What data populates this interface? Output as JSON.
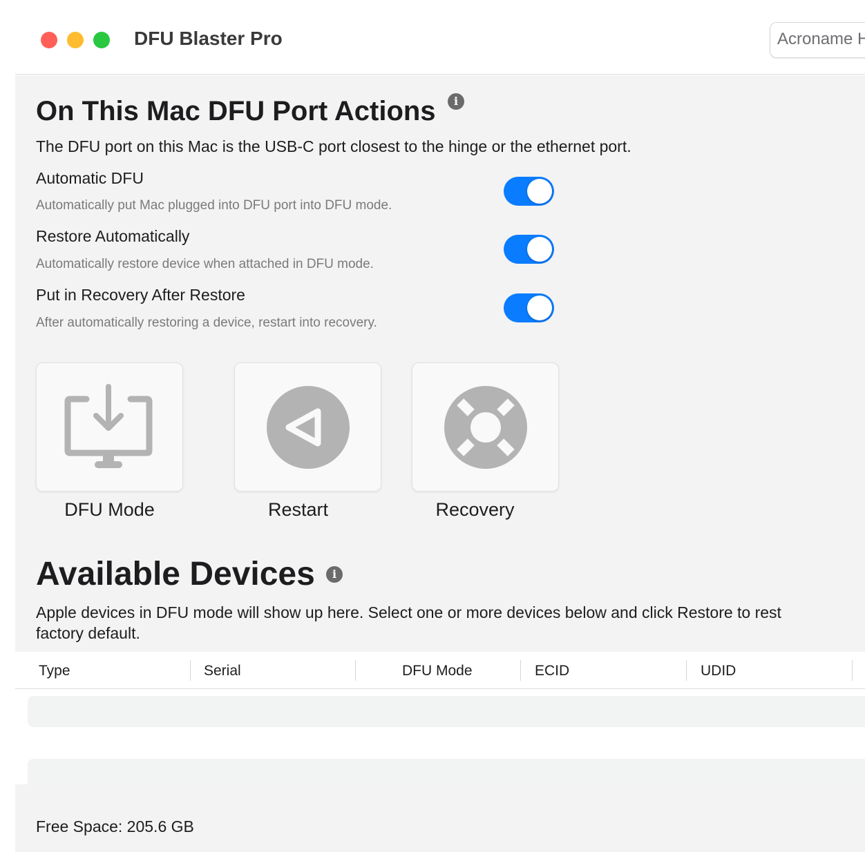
{
  "window": {
    "app_title": "DFU Blaster Pro",
    "hub_selector_value": "Acroname H"
  },
  "port_actions": {
    "title": "On This Mac DFU Port Actions",
    "info_icon": "info-icon",
    "description": "The DFU port on this Mac is the USB-C port closest to the hinge or the ethernet port.",
    "settings": [
      {
        "title": "Automatic DFU",
        "subtitle": "Automatically put Mac plugged into DFU port into DFU mode.",
        "enabled": true
      },
      {
        "title": "Restore Automatically",
        "subtitle": "Automatically restore device when attached in DFU mode.",
        "enabled": true
      },
      {
        "title": "Put in Recovery After Restore",
        "subtitle": "After automatically restoring a device, restart into recovery.",
        "enabled": true
      }
    ],
    "actions": [
      {
        "label": "DFU Mode",
        "icon": "dfu-download-icon"
      },
      {
        "label": "Restart",
        "icon": "restart-icon"
      },
      {
        "label": "Recovery",
        "icon": "recovery-lifebuoy-icon"
      }
    ]
  },
  "devices": {
    "title": "Available Devices",
    "description_line1": "Apple devices in DFU mode will show up here. Select one or more devices below and click Restore to rest",
    "description_line2": "factory default.",
    "columns": [
      "Type",
      "Serial",
      "DFU Mode",
      "ECID",
      "UDID"
    ],
    "rows": []
  },
  "status": {
    "free_space": "Free Space: 205.6 GB"
  },
  "colors": {
    "toggle_on": "#0a7cff",
    "close": "#ff5f57",
    "minimize": "#febc2e",
    "zoom": "#28c840",
    "icon_gray": "#b3b3b3"
  }
}
